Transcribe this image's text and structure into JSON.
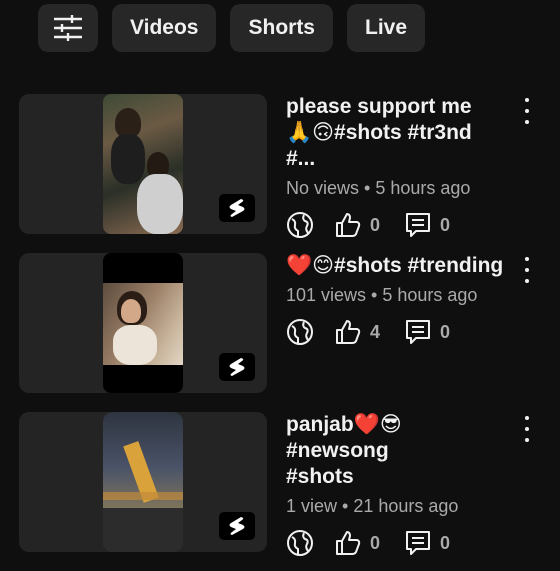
{
  "chips": {
    "filter_icon": "sliders-icon",
    "videos": "Videos",
    "shorts": "Shorts",
    "live": "Live"
  },
  "videos": [
    {
      "title_line1": "please support me",
      "title_line2": "🙏🙃#shots #tr3nd #...",
      "meta": "No views • 5 hours ago",
      "likes": "0",
      "comments": "0"
    },
    {
      "title_line1": "❤️😊#shots #trending",
      "title_line2": "",
      "meta": "101 views • 5 hours ago",
      "likes": "4",
      "comments": "0"
    },
    {
      "title_line1": "panjab❤️😎 #newsong",
      "title_line2": "#shots",
      "meta": "1 view • 21 hours ago",
      "likes": "0",
      "comments": "0"
    }
  ]
}
